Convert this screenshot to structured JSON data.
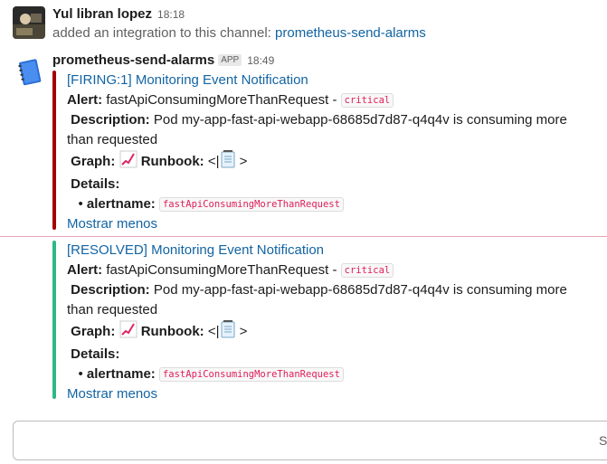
{
  "message1": {
    "author": "Yul libran lopez",
    "time": "18:18",
    "text_prefix": "added an integration to this channel: ",
    "channel_link": "prometheus-send-alarms"
  },
  "message2": {
    "author": "prometheus-send-alarms",
    "badge": "APP",
    "time": "18:49"
  },
  "firing": {
    "title": "[FIRING:1] Monitoring Event Notification",
    "alert_label": "Alert:",
    "alert_value": "fastApiConsumingMoreThanRequest -",
    "severity": "critical",
    "description_label": "Description:",
    "description_line1": "Pod my-app-fast-api-webapp-68685d7d87-q4q4v is consuming more",
    "description_line2": "than requested",
    "graph_label": "Graph:",
    "runbook_label": "Runbook:",
    "runbook_open": "<|",
    "runbook_close": ">",
    "details_label": "Details:",
    "alertname_label": "alertname:",
    "alertname_value": "fastApiConsumingMoreThanRequest",
    "show_less": "Mostrar menos",
    "color": "#a30200"
  },
  "resolved": {
    "title": "[RESOLVED] Monitoring Event Notification",
    "alert_label": "Alert:",
    "alert_value": "fastApiConsumingMoreThanRequest -",
    "severity": "critical",
    "description_label": "Description:",
    "description_line1": "Pod my-app-fast-api-webapp-68685d7d87-q4q4v is consuming more",
    "description_line2": "than requested",
    "graph_label": "Graph:",
    "runbook_label": "Runbook:",
    "runbook_open": "<|",
    "runbook_close": ">",
    "details_label": "Details:",
    "alertname_label": "alertname:",
    "alertname_value": "fastApiConsumingMoreThanRequest",
    "show_less": "Mostrar menos",
    "color": "#2eb886"
  },
  "composer": {
    "hint": "Se"
  }
}
